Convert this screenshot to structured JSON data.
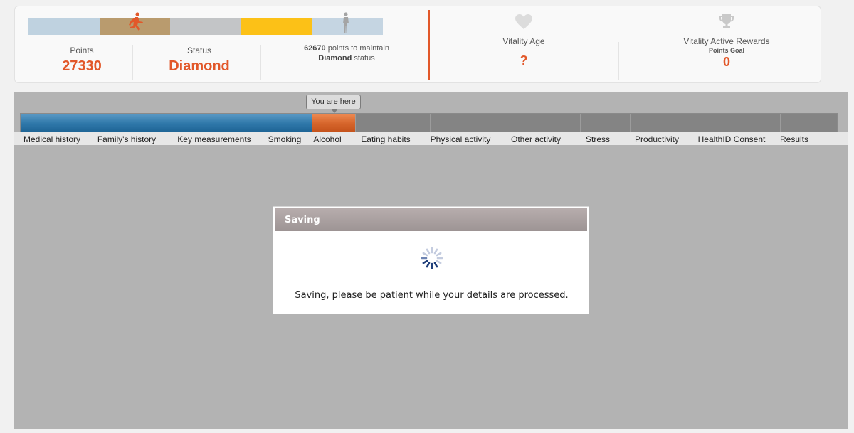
{
  "status_card": {
    "tier_colors": [
      "#bfd2e0",
      "#b99b6e",
      "#c3c5c7",
      "#fcc117",
      "#c5d5e2"
    ],
    "points": {
      "label": "Points",
      "value": "27330"
    },
    "status": {
      "label": "Status",
      "value": "Diamond"
    },
    "maintain": {
      "points": "62670",
      "text_mid": "points to maintain",
      "status_word": "Diamond",
      "text_end": "status"
    },
    "vitality_age": {
      "label": "Vitality Age",
      "value": "?",
      "icon": "heart-icon"
    },
    "rewards": {
      "label": "Vitality Active Rewards",
      "sub": "Points Goal",
      "value": "0",
      "icon": "trophy-icon"
    }
  },
  "progress": {
    "tooltip": "You are here",
    "steps": [
      "Medical history",
      "Family's history",
      "Key measurements",
      "Smoking",
      "Alcohol",
      "Eating habits",
      "Physical activity",
      "Other activity",
      "Stress",
      "Productivity",
      "HealthID Consent",
      "Results"
    ],
    "completed_steps": 4,
    "current_step": "Alcohol",
    "colors": {
      "completed": "#2f78aa",
      "current": "#d6652b",
      "pending": "#848484"
    }
  },
  "modal": {
    "title": "Saving",
    "message": "Saving, please be patient while your details are processed."
  }
}
